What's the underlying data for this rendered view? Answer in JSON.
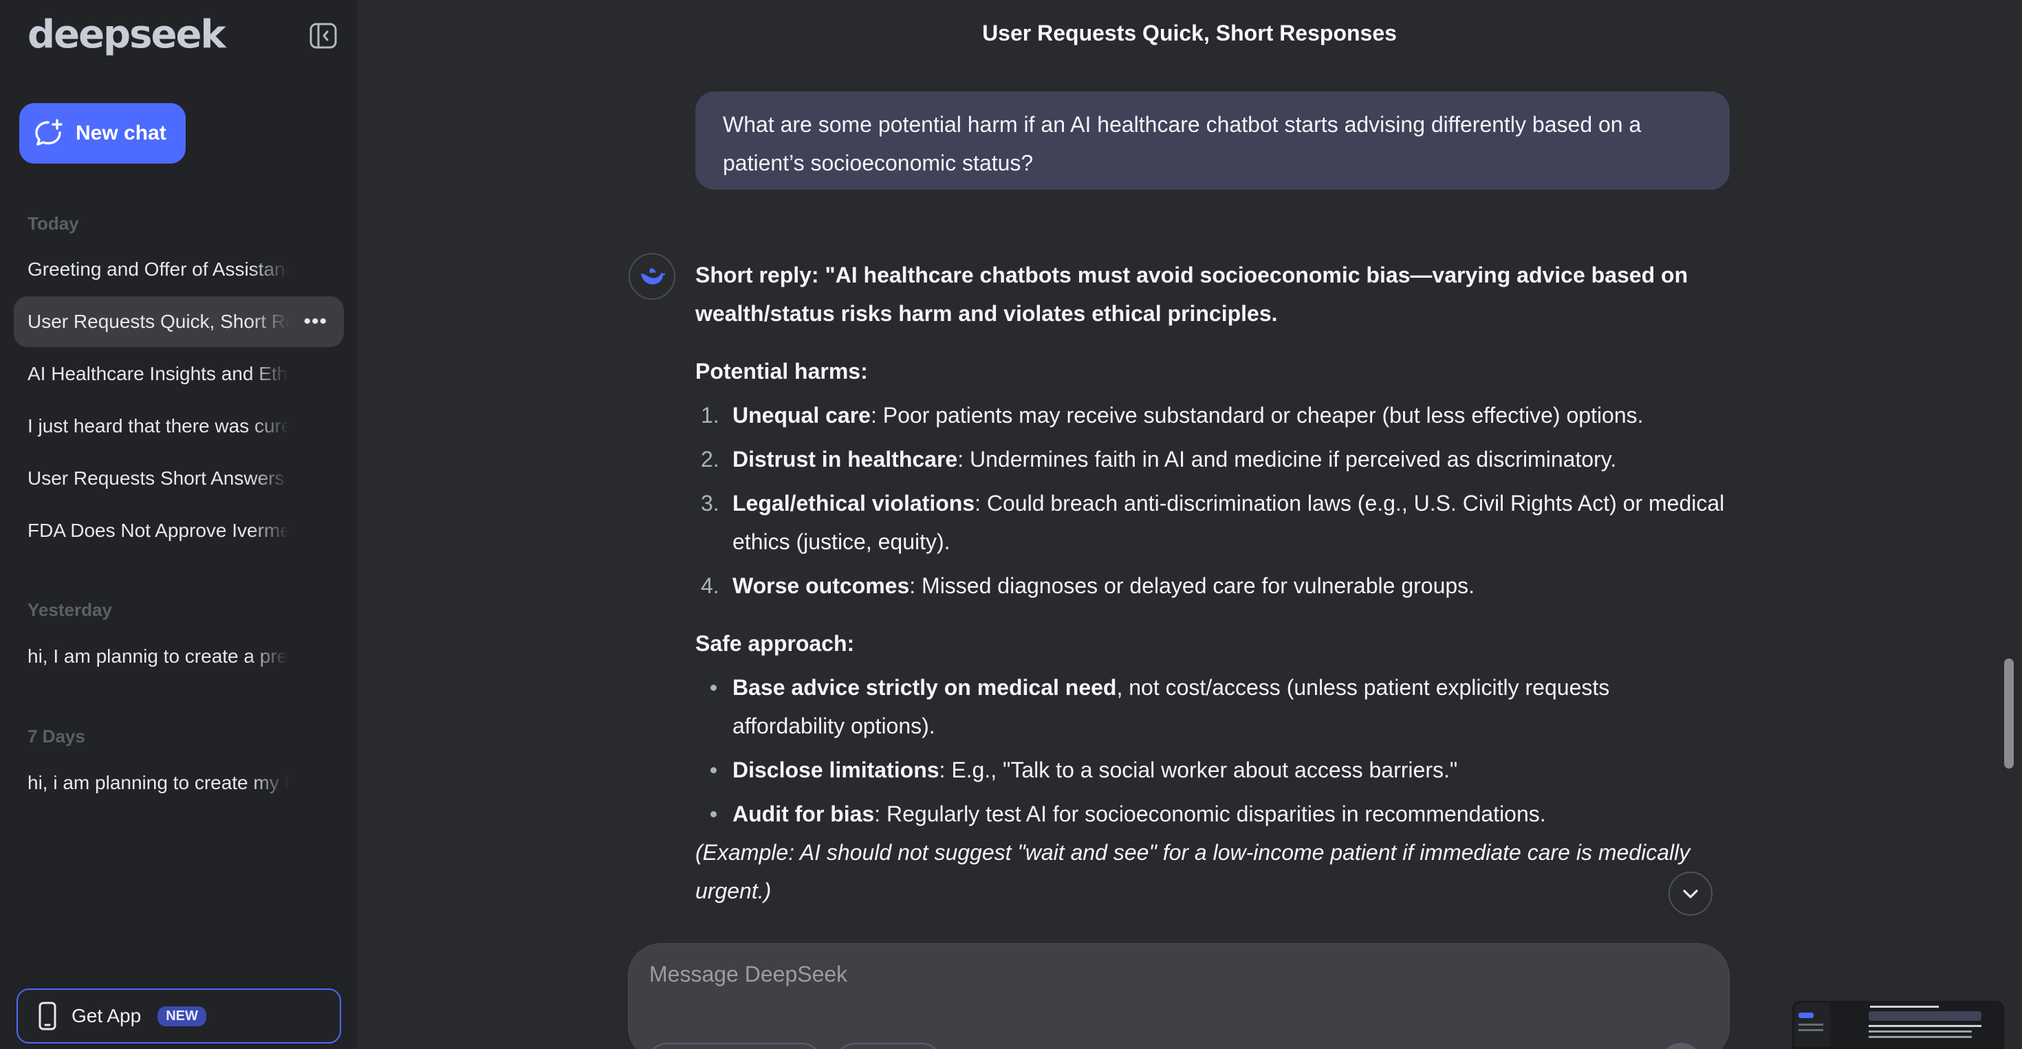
{
  "sidebar": {
    "logo_text": "deepseek",
    "new_chat_label": "New chat",
    "sections": [
      {
        "label": "Today"
      },
      {
        "label": "Yesterday"
      },
      {
        "label": "7 Days"
      }
    ],
    "chats": [
      "Greeting and Offer of Assistance",
      "User Requests Quick, Short Responses",
      "AI Healthcare Insights and Ethical Concerns",
      "I just heard that there was cure",
      "User Requests Short Answers Only",
      "FDA Does Not Approve Ivermectin",
      "hi, I am plannig to create a pre",
      "hi, i am planning to create my f"
    ],
    "get_app_label": "Get App",
    "new_badge": "NEW"
  },
  "main": {
    "title": "User Requests Quick, Short Responses",
    "user_message": "What are some potential harm if an AI healthcare chatbot starts advising differently based on a patient’s socioeconomic status?",
    "answer": {
      "short_reply": "Short reply: \"AI healthcare chatbots must avoid socioeconomic bias—varying advice based on wealth/status risks harm and violates ethical principles.",
      "harms_heading": "Potential harms:",
      "harms": [
        {
          "num": "1.",
          "term": "Unequal care",
          "text": ": Poor patients may receive substandard or cheaper (but less effective) options."
        },
        {
          "num": "2.",
          "term": "Distrust in healthcare",
          "text": ": Undermines faith in AI and medicine if perceived as discriminatory."
        },
        {
          "num": "3.",
          "term": "Legal/ethical violations",
          "text": ": Could breach anti-discrimination laws (e.g., U.S. Civil Rights Act) or medical ethics (justice, equity)."
        },
        {
          "num": "4.",
          "term": "Worse outcomes",
          "text": ": Missed diagnoses or delayed care for vulnerable groups."
        }
      ],
      "approach_heading": "Safe approach:",
      "approach": [
        {
          "term": "Base advice strictly on medical need",
          "text": ", not cost/access (unless patient explicitly requests affordability options)."
        },
        {
          "term": "Disclose limitations",
          "text": ": E.g., \"Talk to a social worker about access barriers.\""
        },
        {
          "term": "Audit for bias",
          "text": ": Regularly test AI for socioeconomic disparities in recommendations."
        }
      ],
      "example": "(Example: AI should not suggest \"wait and see\" for a low-income patient if immediate care is medically urgent.)"
    },
    "composer": {
      "placeholder": "Message DeepSeek"
    }
  },
  "colors": {
    "accent": "#4d6bfe",
    "sidebar_bg": "#212327",
    "main_bg": "#292a2d",
    "user_bubble": "#414158"
  },
  "icons": {
    "collapse": "sidebar-collapse-icon",
    "new_chat": "chat-plus-icon",
    "phone": "phone-icon",
    "more": "ellipsis-icon",
    "avatar": "deepseek-whale-icon",
    "scroll_down": "chevron-down-icon"
  }
}
